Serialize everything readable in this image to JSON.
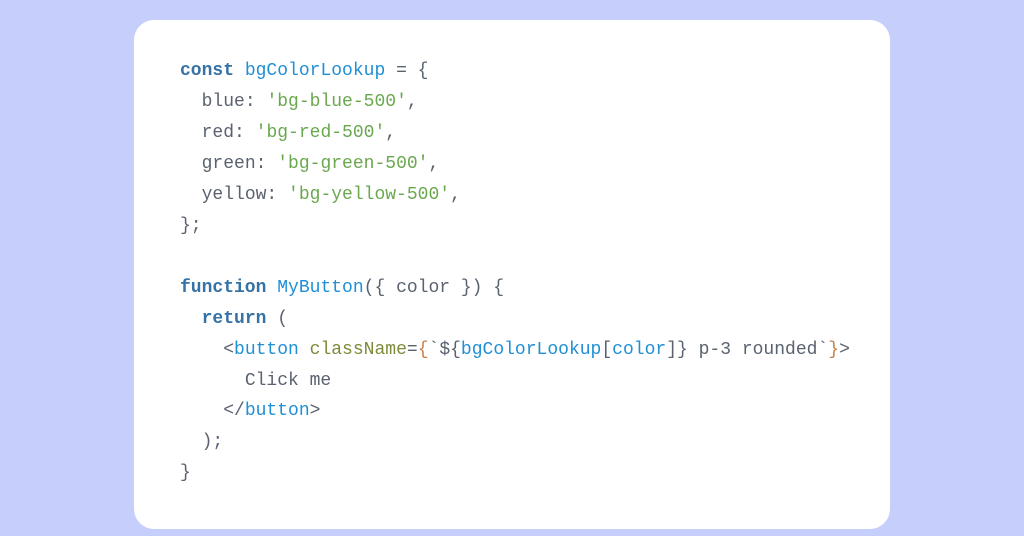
{
  "code": {
    "kw_const": "const",
    "id_lookup": "bgColorLookup",
    "eq_open": " = {",
    "prop_blue": "blue",
    "val_blue": "bg-blue-500",
    "prop_red": "red",
    "val_red": "bg-red-500",
    "prop_green": "green",
    "val_green": "bg-green-500",
    "prop_yellow": "yellow",
    "val_yellow": "bg-yellow-500",
    "close_obj": "};",
    "kw_function": "function",
    "id_component": "MyButton",
    "fn_sig_open": "({ ",
    "param_color": "color",
    "fn_sig_close": " }) {",
    "kw_return": "return",
    "return_open": " (",
    "lt_open": "<",
    "tag_button": "button",
    "attr_className": "className",
    "eq": "=",
    "brace_open": "{",
    "backtick": "`",
    "interp_open": "${",
    "lookup_ref": "bgColorLookup",
    "bracket_open": "[",
    "color_ref": "color",
    "bracket_close": "]",
    "interp_close": "}",
    "tmpl_tail": " p-3 rounded",
    "brace_close": "}",
    "gt": ">",
    "button_text": "Click me",
    "lt_close": "</",
    "paren_close": ");",
    "fn_close": "}"
  }
}
